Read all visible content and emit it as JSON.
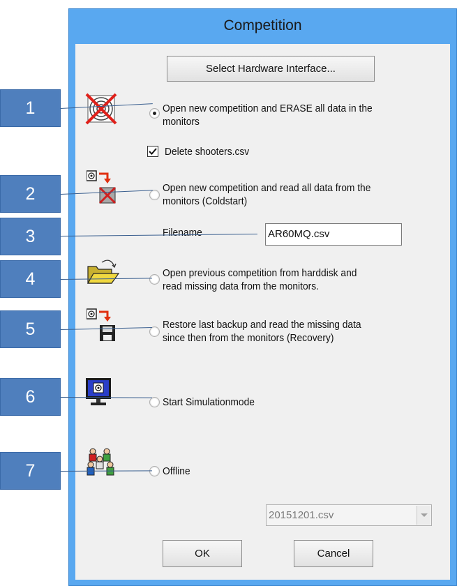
{
  "window": {
    "title": "Competition"
  },
  "buttons": {
    "hardware": "Select Hardware Interface...",
    "ok": "OK",
    "cancel": "Cancel"
  },
  "options": [
    {
      "label_line1": "Open new competition and ERASE all data in the",
      "label_line2": "monitors",
      "selected": true,
      "icon": "target-crossed-out-icon"
    },
    {
      "label_line1": "Open new competition and read all data from the",
      "label_line2": "monitors (Coldstart)",
      "selected": false,
      "icon": "target-to-crossed-disk-icon"
    },
    {
      "label_line1": "Open previous competition from harddisk and",
      "label_line2": "read missing data from the monitors.",
      "selected": false,
      "icon": "open-folder-icon"
    },
    {
      "label_line1": "Restore last backup and read the missing data",
      "label_line2": "since then from the monitors (Recovery)",
      "selected": false,
      "icon": "target-to-floppy-icon"
    },
    {
      "label_line1": "Start Simulationmode",
      "label_line2": "",
      "selected": false,
      "icon": "monitor-target-icon"
    },
    {
      "label_line1": "Offline",
      "label_line2": "",
      "selected": false,
      "icon": "people-group-icon"
    }
  ],
  "delete_shooters": {
    "label": "Delete shooters.csv",
    "checked": true
  },
  "filename": {
    "label": "Filename",
    "value": "AR60MQ.csv"
  },
  "offline_file": {
    "selected": "20151201.csv"
  },
  "callouts": [
    "1",
    "2",
    "3",
    "4",
    "5",
    "6",
    "7"
  ],
  "colors": {
    "titlebar": "#59a8f0",
    "callout": "#4f7fbd",
    "dialog_bg": "#f0f0f0"
  }
}
